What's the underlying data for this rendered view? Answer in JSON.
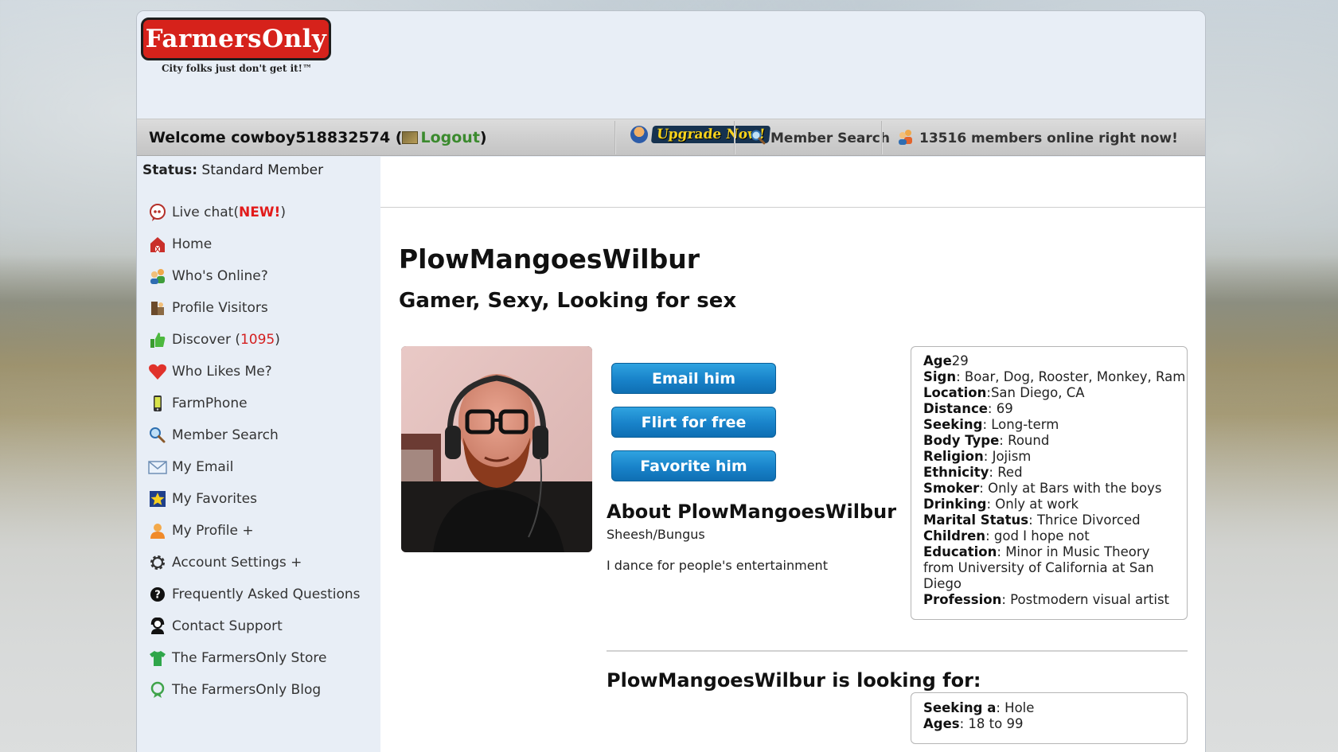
{
  "header": {
    "logo_text": "FarmersOnly",
    "logo_tagline": "City folks just don't get it!™"
  },
  "navbar": {
    "welcome_prefix": "Welcome cowboy518832574 (",
    "logout_label": "Logout",
    "welcome_suffix": ")",
    "upgrade_label": "Upgrade Now!",
    "member_search_label": "Member Search",
    "online_label": "13516 members online right now!"
  },
  "sidebar": {
    "status_label": "Status:",
    "status_value": "Standard Member",
    "items": [
      {
        "label": "Live chat(",
        "badge": "NEW!",
        "suffix": ")",
        "icon": "chat-bubble-icon"
      },
      {
        "label": "Home",
        "icon": "barn-icon"
      },
      {
        "label": "Who's Online?",
        "icon": "people-icon"
      },
      {
        "label": "Profile Visitors",
        "icon": "visitors-icon"
      },
      {
        "label": "Discover (",
        "count": "1095",
        "suffix": ")",
        "icon": "thumbs-up-icon"
      },
      {
        "label": "Who Likes Me?",
        "icon": "heart-icon"
      },
      {
        "label": "FarmPhone",
        "icon": "phone-icon"
      },
      {
        "label": "Member Search",
        "icon": "magnifier-icon"
      },
      {
        "label": "My Email",
        "icon": "envelope-icon"
      },
      {
        "label": "My Favorites",
        "icon": "star-icon"
      },
      {
        "label": "My Profile +",
        "icon": "profile-icon"
      },
      {
        "label": "Account Settings +",
        "icon": "gear-icon"
      },
      {
        "label": "Frequently Asked Questions",
        "icon": "question-icon"
      },
      {
        "label": "Contact Support",
        "icon": "support-icon"
      },
      {
        "label": "The FarmersOnly Store",
        "icon": "shirt-icon"
      },
      {
        "label": "The FarmersOnly Blog",
        "icon": "blog-icon"
      }
    ]
  },
  "profile": {
    "name": "PlowMangoesWilbur",
    "headline": "Gamer, Sexy, Looking for sex",
    "buttons": {
      "email": "Email him",
      "flirt": "Flirt for free",
      "favorite": "Favorite him"
    },
    "about_title": "About PlowMangoesWilbur",
    "about_sub": "Sheesh/Bungus",
    "about_body": "I dance for people's entertainment",
    "details": [
      {
        "label": "Age",
        "sep": "",
        "value": "29"
      },
      {
        "label": "Sign",
        "sep": ": ",
        "value": "Boar, Dog, Rooster, Monkey, Ram"
      },
      {
        "label": "Location",
        "sep": ":",
        "value": "San Diego, CA"
      },
      {
        "label": "Distance",
        "sep": ": ",
        "value": "69"
      },
      {
        "label": "Seeking",
        "sep": ": ",
        "value": "Long-term"
      },
      {
        "label": "Body Type",
        "sep": ": ",
        "value": "Round"
      },
      {
        "label": "Religion",
        "sep": ": ",
        "value": "Jojism"
      },
      {
        "label": "Ethnicity",
        "sep": ": ",
        "value": "Red"
      },
      {
        "label": "Smoker",
        "sep": ": ",
        "value": "Only at Bars with the boys"
      },
      {
        "label": "Drinking",
        "sep": ": ",
        "value": "Only at work"
      },
      {
        "label": "Marital Status",
        "sep": ": ",
        "value": "Thrice Divorced"
      },
      {
        "label": "Children",
        "sep": ": ",
        "value": "god I hope not"
      },
      {
        "label": "Education",
        "sep": ": ",
        "value": "Minor in Music Theory from University of California at San Diego"
      },
      {
        "label": "Profession",
        "sep": ": ",
        "value": "Postmodern visual artist"
      }
    ],
    "looking_title": "PlowMangoesWilbur is looking for:",
    "looking": [
      {
        "label": "Seeking a",
        "sep": ": ",
        "value": "Hole"
      },
      {
        "label": "Ages",
        "sep": ": ",
        "value": "18 to 99"
      }
    ]
  },
  "colors": {
    "logo_red": "#d6221b",
    "logout_green": "#3b8a2e",
    "button_blue": "#1882c9",
    "badge_red": "#e21b1b",
    "page_bg": "#e8eef6"
  }
}
